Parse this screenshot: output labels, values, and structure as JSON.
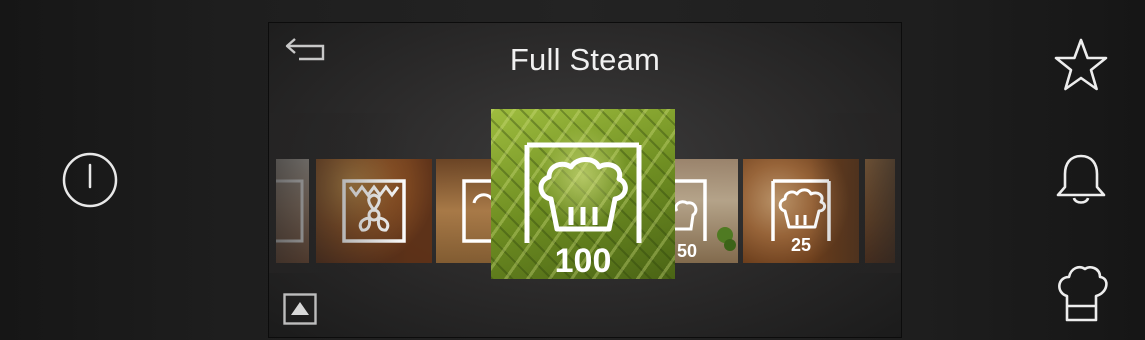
{
  "program": {
    "title": "Full Steam"
  },
  "icons": {
    "power": "power-icon",
    "back": "back-arrow-icon",
    "favorite": "star-icon",
    "timer": "bell-icon",
    "recipes": "chef-hat-icon",
    "menu_up": "triangle-up-icon"
  },
  "carousel": {
    "tiles": [
      {
        "name": "partial-tile",
        "value": ""
      },
      {
        "name": "fan-bake-tile",
        "value": ""
      },
      {
        "name": "muffin-tile",
        "value": ""
      },
      {
        "name": "full-steam-tile",
        "value": "100",
        "selected": true
      },
      {
        "name": "steam-50-tile",
        "value": "50"
      },
      {
        "name": "steam-25-tile",
        "value": "25"
      },
      {
        "name": "partial-right-tile",
        "value": ""
      }
    ]
  },
  "colors": {
    "icon_white": "#ffffff",
    "frame_dark": "#0c0c0c",
    "cabbage_green": "#7fa02a"
  }
}
